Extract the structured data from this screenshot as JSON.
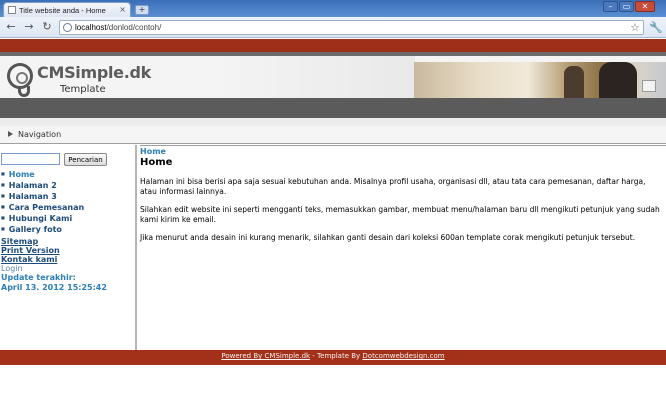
{
  "browser": {
    "tab_title": "Title website anda - Home",
    "tab_close": "×",
    "new_tab": "+",
    "url_host": "localhost",
    "url_path": "/donlod/contoh/",
    "win_min": "–",
    "win_max": "▭",
    "win_close": "✕"
  },
  "header": {
    "brand": "CMSimple.dk",
    "brand_sub": "Template"
  },
  "navbar": {
    "label": "Navigation"
  },
  "sidebar": {
    "search_button": "Pencarian",
    "menu": [
      {
        "label": "Home"
      },
      {
        "label": "Halaman 2"
      },
      {
        "label": "Halaman 3"
      },
      {
        "label": "Cara Pemesanan"
      },
      {
        "label": "Hubungi Kami"
      },
      {
        "label": "Gallery foto"
      }
    ],
    "sitemap": "Sitemap",
    "print_version": "Print Version",
    "kontak": "Kontak kami",
    "login": "Login",
    "update_label": "Update terakhir:",
    "update_value": "April 13. 2012 15:25:42"
  },
  "content": {
    "breadcrumb": "Home",
    "title": "Home",
    "paragraphs": [
      "Halaman ini bisa berisi apa saja sesuai kebutuhan anda. Misalnya profil usaha, organisasi dll, atau tata cara pemesanan, daftar harga, atau informasi lainnya.",
      "Silahkan edit website ini seperti mengganti teks, memasukkan gambar, membuat menu/halaman baru dll mengikuti petunjuk yang sudah kami kirim ke email.",
      "Jika menurut anda desain ini kurang menarik, silahkan ganti desain dari koleksi 600an template corak mengikuti petunjuk tersebut."
    ]
  },
  "footer": {
    "powered": "Powered By CMSimple.dk",
    "sep": " - Template By ",
    "designer": "Dotcomwebdesign.com"
  }
}
